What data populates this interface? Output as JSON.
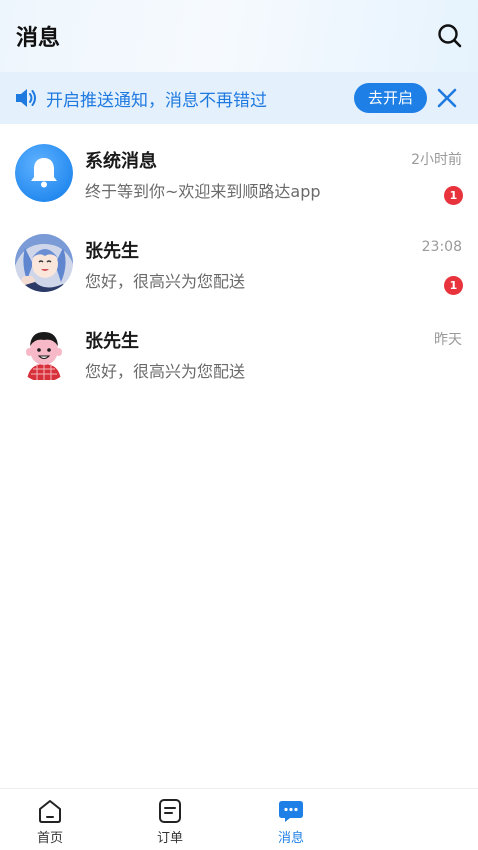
{
  "header": {
    "title": "消息",
    "search_icon": "search-icon"
  },
  "banner": {
    "icon": "speaker-icon",
    "text": "开启推送通知，消息不再错过",
    "enable_label": "去开启",
    "close_icon": "close-icon"
  },
  "messages": [
    {
      "name": "系统消息",
      "preview": "终于等到你~欢迎来到顺路达app",
      "time": "2小时前",
      "badge": "1",
      "avatar": "bell-icon"
    },
    {
      "name": "张先生",
      "preview": "您好，很高兴为您配送",
      "time": "23:08",
      "badge": "1",
      "avatar": "anime-avatar"
    },
    {
      "name": "张先生",
      "preview": "您好，很高兴为您配送",
      "time": "昨天",
      "avatar": "cartoon-avatar"
    }
  ],
  "tabs": [
    {
      "label": "首页",
      "icon": "home-icon"
    },
    {
      "label": "订单",
      "icon": "order-icon"
    },
    {
      "label": "消息",
      "icon": "message-icon",
      "active": true
    }
  ],
  "colors": {
    "accent": "#1e7fe6",
    "badge": "#e8323c",
    "banner_bg": "#e4f0fc"
  }
}
